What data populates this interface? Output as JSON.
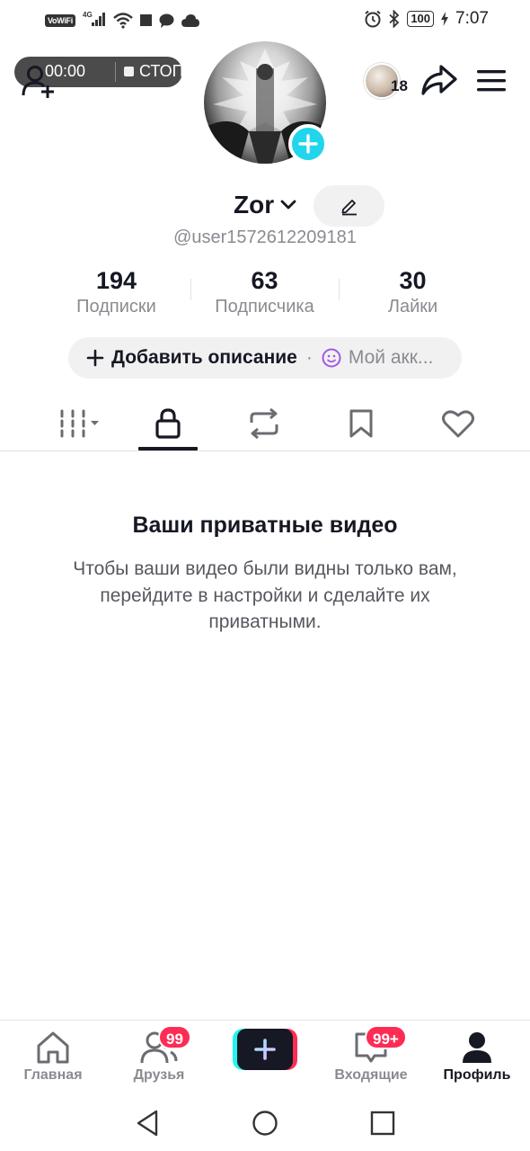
{
  "status_bar": {
    "vowifi": "VoWiFi",
    "network": "4G",
    "battery": "100",
    "time": "7:07"
  },
  "recording": {
    "timer": "00:00",
    "stop_label": "СТОП"
  },
  "header": {
    "story_count": "18"
  },
  "profile": {
    "display_name": "Zor",
    "handle": "@user1572612209181"
  },
  "stats": [
    {
      "value": "194",
      "label": "Подписки"
    },
    {
      "value": "63",
      "label": "Подписчика"
    },
    {
      "value": "30",
      "label": "Лайки"
    }
  ],
  "bio": {
    "add_description": "Добавить описание",
    "separator": "·",
    "account_label": "Мой акк..."
  },
  "tabs": [
    {
      "icon": "grid-filter-icon",
      "active": false
    },
    {
      "icon": "lock-icon",
      "active": true
    },
    {
      "icon": "repost-icon",
      "active": false
    },
    {
      "icon": "bookmark-icon",
      "active": false
    },
    {
      "icon": "heart-icon",
      "active": false
    }
  ],
  "empty_state": {
    "title": "Ваши приватные видео",
    "body": "Чтобы ваши видео были видны только вам, перейдите в настройки и сделайте их приватными."
  },
  "bottom_nav": {
    "home": "Главная",
    "friends": "Друзья",
    "friends_badge": "99",
    "inbox": "Входящие",
    "inbox_badge": "99+",
    "profile": "Профиль"
  },
  "colors": {
    "accent_cyan": "#25f4ee",
    "accent_pink": "#fe2c55",
    "avatar_add": "#20d5ec",
    "text_primary": "#161823",
    "text_secondary": "#8a8b91"
  }
}
